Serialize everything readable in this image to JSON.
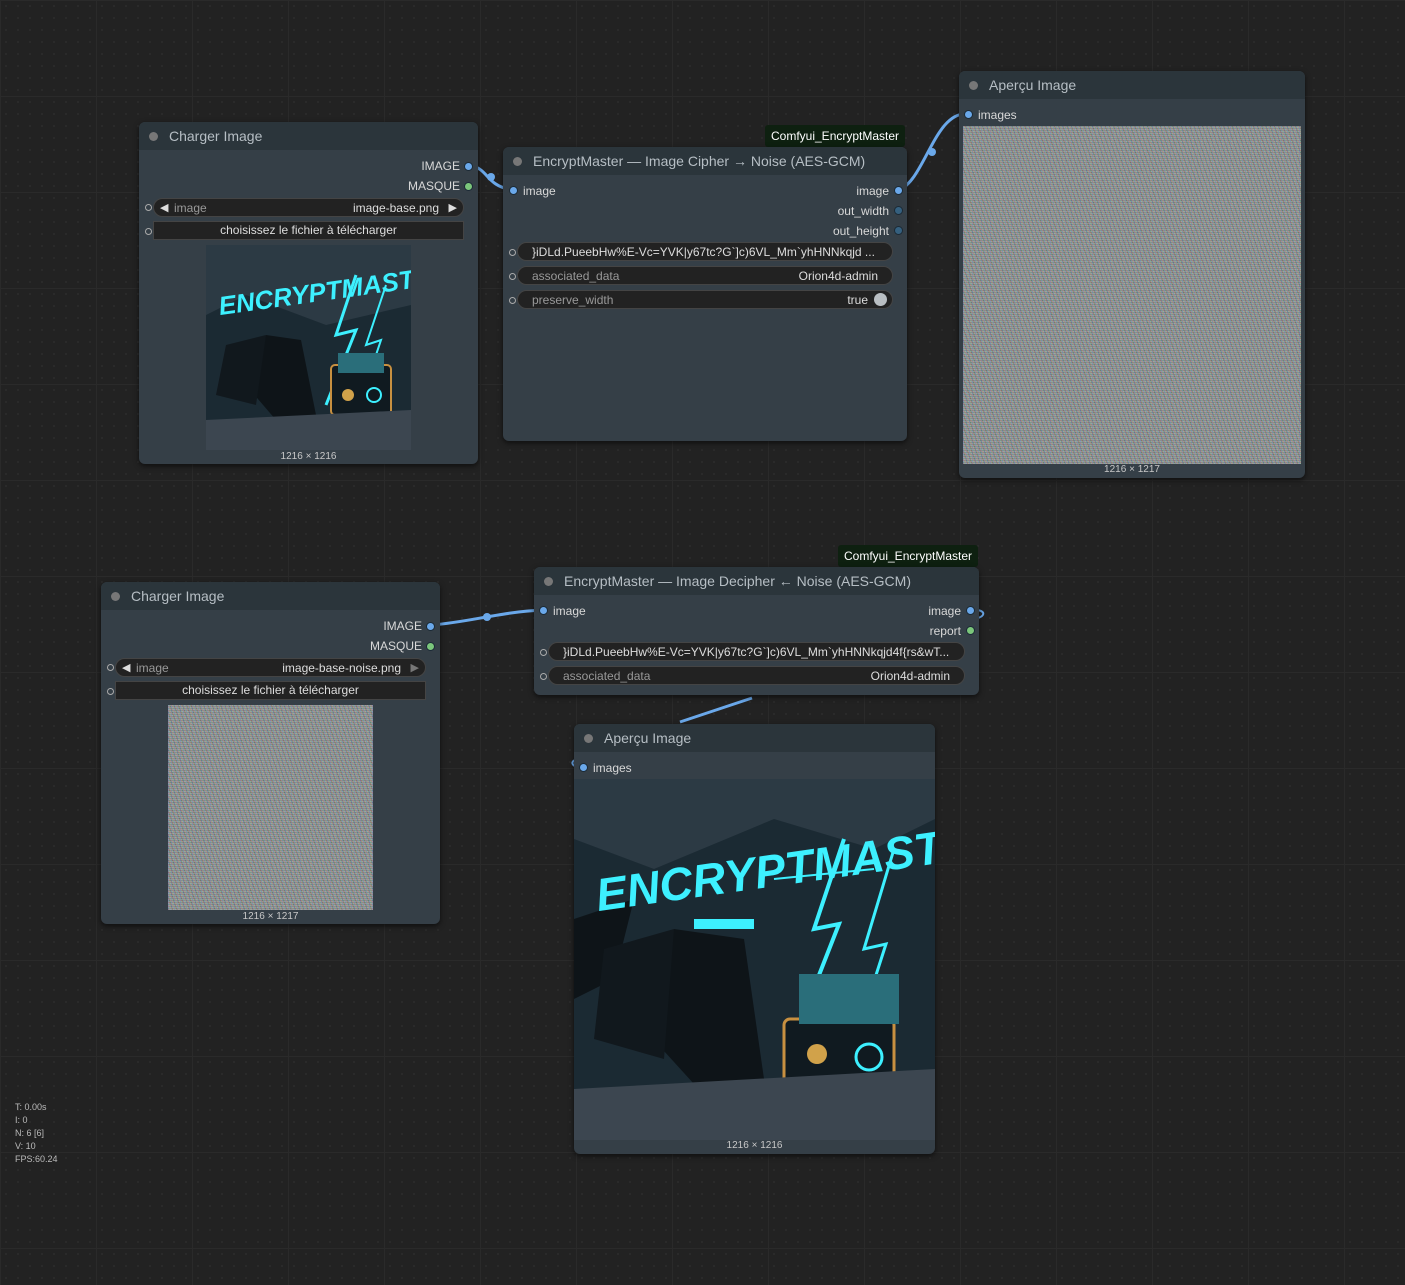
{
  "colors": {
    "canvas": "#222222",
    "node_bg": "#353f47",
    "node_title_bg": "#2b353b",
    "link_blue": "#6aa8ea",
    "mask_green": "#7bc67b",
    "badge_bg": "#0e2010"
  },
  "node_load1": {
    "title": "Charger Image",
    "out_image": "IMAGE",
    "out_mask": "MASQUE",
    "image_label": "image",
    "image_value": "image-base.png",
    "upload_label": "choisissez le fichier à télécharger",
    "caption": "1216 × 1216"
  },
  "node_cipher": {
    "badge": "Comfyui_EncryptMaster",
    "title": "EncryptMaster — Image Cipher → Noise (AES-GCM)",
    "in_image": "image",
    "out_image": "image",
    "out_width": "out_width",
    "out_height": "out_height",
    "key_value": "}iDLd.PueebHw%E-Vc=YVK|y67tc?G`]c)6VL_Mm`yhHNNkqjd ...",
    "assoc_label": "associated_data",
    "assoc_value": "Orion4d-admin",
    "preserve_label": "preserve_width",
    "preserve_value": "true"
  },
  "node_preview1": {
    "title": "Aperçu Image",
    "in_images": "images",
    "caption": "1216 × 1217"
  },
  "node_load2": {
    "title": "Charger Image",
    "out_image": "IMAGE",
    "out_mask": "MASQUE",
    "image_label": "image",
    "image_value": "image-base-noise.png",
    "upload_label": "choisissez le fichier à télécharger",
    "caption": "1216 × 1217"
  },
  "node_decipher": {
    "badge": "Comfyui_EncryptMaster",
    "title": "EncryptMaster — Image Decipher ← Noise (AES-GCM)",
    "in_image": "image",
    "out_image": "image",
    "out_report": "report",
    "key_value": "}iDLd.PueebHw%E-Vc=YVK|y67tc?G`]c)6VL_Mm`yhHNNkqjd4f{rs&wT...",
    "assoc_label": "associated_data",
    "assoc_value": "Orion4d-admin"
  },
  "node_preview2": {
    "title": "Aperçu Image",
    "in_images": "images",
    "caption": "1216 × 1216"
  },
  "artwork_text": "ENCRYPTMASTER",
  "stats": {
    "t": "T: 0.00s",
    "i": "I: 0",
    "n": "N: 6 [6]",
    "v": "V: 10",
    "fps": "FPS:60.24"
  }
}
